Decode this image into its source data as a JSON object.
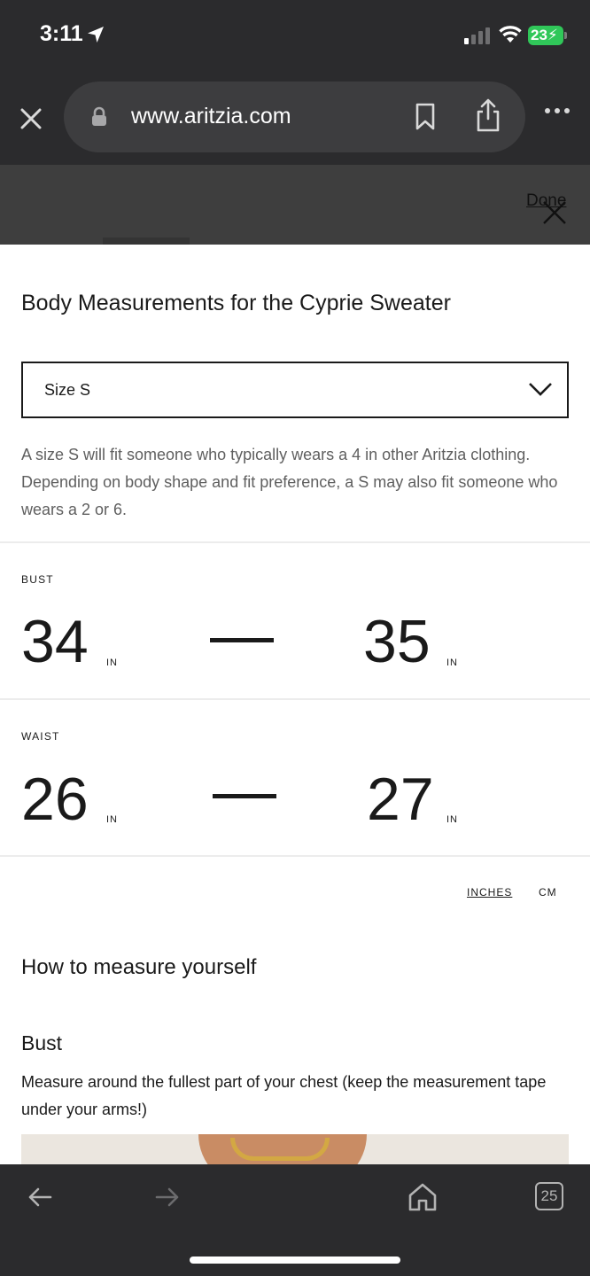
{
  "status_bar": {
    "time": "3:11",
    "battery": "23",
    "icons": [
      "location-arrow-icon",
      "signal-icon",
      "wifi-icon",
      "battery-charging-icon"
    ]
  },
  "browser": {
    "url": "www.aritzia.com",
    "icons": [
      "close-icon",
      "lock-icon",
      "bookmark-icon",
      "share-icon",
      "more-icon"
    ]
  },
  "background_page": {
    "done_label": "Done"
  },
  "modal": {
    "title": "Body Measurements for the Cyprie Sweater",
    "size_select": {
      "value": "Size S"
    },
    "fit_description": "A size S will fit someone who typically wears a 4 in other Aritzia clothing. Depending on body shape and fit preference, a S may also fit someone who wears a 2 or 6.",
    "measurements": [
      {
        "label": "BUST",
        "min": "34",
        "max": "35",
        "unit": "IN"
      },
      {
        "label": "WAIST",
        "min": "26",
        "max": "27",
        "unit": "IN"
      }
    ],
    "unit_toggle": {
      "inches": "INCHES",
      "cm": "CM",
      "selected": "INCHES"
    },
    "how_to_title": "How to measure yourself",
    "bust_section": {
      "title": "Bust",
      "description": "Measure around the fullest part of your chest (keep the measurement tape under your arms!)"
    }
  },
  "toolbar": {
    "tabs_count": "25",
    "icons": [
      "back-icon",
      "forward-icon",
      "home-icon",
      "tabs-icon"
    ]
  },
  "colors": {
    "chrome_bg": "#2b2b2d",
    "url_pill": "#3d3d3f",
    "battery_green": "#30c759",
    "text_primary": "#1a1a1a",
    "text_secondary": "#5f5f5f"
  }
}
